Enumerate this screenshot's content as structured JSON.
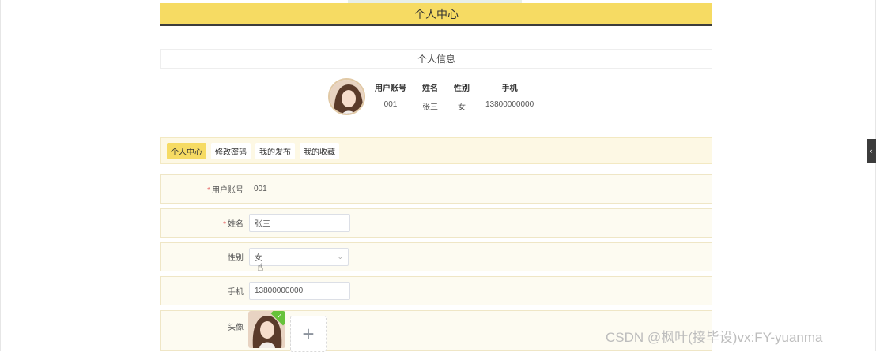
{
  "header": {
    "title": "个人中心"
  },
  "info": {
    "title": "个人信息",
    "columns": [
      {
        "label": "用户账号",
        "value": "001"
      },
      {
        "label": "姓名",
        "value": "张三"
      },
      {
        "label": "性别",
        "value": "女"
      },
      {
        "label": "手机",
        "value": "13800000000"
      }
    ]
  },
  "tabs": [
    {
      "label": "个人中心",
      "active": true
    },
    {
      "label": "修改密码",
      "active": false
    },
    {
      "label": "我的发布",
      "active": false
    },
    {
      "label": "我的收藏",
      "active": false
    }
  ],
  "form": {
    "account": {
      "label": "用户账号",
      "value": "001",
      "required": true
    },
    "name": {
      "label": "姓名",
      "value": "张三",
      "required": true
    },
    "gender": {
      "label": "性别",
      "value": "女"
    },
    "phone": {
      "label": "手机",
      "value": "13800000000"
    },
    "avatar": {
      "label": "头像",
      "add_symbol": "+"
    }
  },
  "colors": {
    "accent": "#f6db63",
    "tab_bg": "#fdf8e4",
    "required": "#e55c5c",
    "success": "#67c23a"
  },
  "icons": {
    "select_arrow": "chevron-down-icon",
    "upload": "plus-icon",
    "side_toggle": "chevron-left-icon"
  },
  "side_toggle": {
    "glyph": "‹"
  },
  "watermark": "CSDN @枫叶(接毕设)vx:FY-yuanma"
}
